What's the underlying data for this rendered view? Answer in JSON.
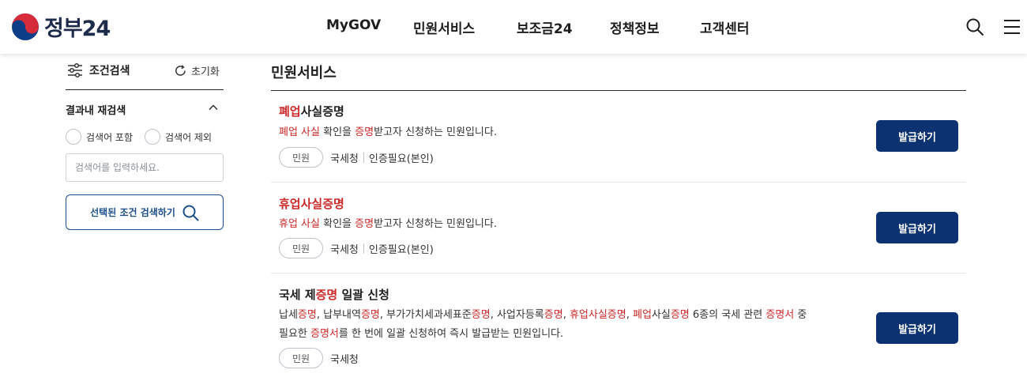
{
  "header": {
    "logo_text": "정부24",
    "nav": [
      "MyGOV",
      "민원서비스",
      "보조금24",
      "정책정보",
      "고객센터"
    ],
    "icons": [
      "search-icon",
      "menu-icon"
    ]
  },
  "sidebar": {
    "title": "조건검색",
    "reset_label": "초기화",
    "refine_title": "결과내 재검색",
    "radio_include": "검색어 포함",
    "radio_exclude": "검색어 제외",
    "search_placeholder": "검색어를 입력하세요.",
    "search_button": "선택된 조건 검색하기"
  },
  "main": {
    "section_title": "민원서비스",
    "issue_label": "발급하기",
    "items": [
      {
        "title": [
          {
            "t": "폐업",
            "h": true
          },
          {
            "t": "사실증명",
            "h": false
          }
        ],
        "desc_lines": [
          [
            {
              "t": "폐업 사실",
              "h": true
            },
            {
              "t": " 확인을 ",
              "h": false
            },
            {
              "t": "증명",
              "h": true
            },
            {
              "t": "받고자 신청하는 민원입니다.",
              "h": false
            }
          ]
        ],
        "tag": "민원",
        "org": "국세청",
        "auth": "인증필요(본인)"
      },
      {
        "title": [
          {
            "t": "휴업사실증명",
            "h": true
          }
        ],
        "desc_lines": [
          [
            {
              "t": "휴업 사실",
              "h": true
            },
            {
              "t": " 확인을 ",
              "h": false
            },
            {
              "t": "증명",
              "h": true
            },
            {
              "t": "받고자 신청하는 민원입니다.",
              "h": false
            }
          ]
        ],
        "tag": "민원",
        "org": "국세청",
        "auth": "인증필요(본인)"
      },
      {
        "title": [
          {
            "t": "국세 제",
            "h": false
          },
          {
            "t": "증명",
            "h": true
          },
          {
            "t": " 일괄 신청",
            "h": false
          }
        ],
        "desc_lines": [
          [
            {
              "t": "납세",
              "h": false
            },
            {
              "t": "증명",
              "h": true
            },
            {
              "t": ", 납부내역",
              "h": false
            },
            {
              "t": "증명",
              "h": true
            },
            {
              "t": ", 부가가치세과세표준",
              "h": false
            },
            {
              "t": "증명",
              "h": true
            },
            {
              "t": ", 사업자등록",
              "h": false
            },
            {
              "t": "증명",
              "h": true
            },
            {
              "t": ", ",
              "h": false
            },
            {
              "t": "휴업사실증명",
              "h": true
            },
            {
              "t": ", ",
              "h": false
            },
            {
              "t": "폐업",
              "h": true
            },
            {
              "t": "사실",
              "h": false
            },
            {
              "t": "증명",
              "h": true
            },
            {
              "t": " 6종의 국세 관련 ",
              "h": false
            },
            {
              "t": "증명서",
              "h": true
            },
            {
              "t": " 중",
              "h": false
            }
          ],
          [
            {
              "t": "필요한 ",
              "h": false
            },
            {
              "t": "증명서",
              "h": true
            },
            {
              "t": "를 한 번에 일괄 신청하여 즉시 발급받는 민원입니다.",
              "h": false
            }
          ]
        ],
        "tag": "민원",
        "org": "국세청",
        "auth": ""
      }
    ]
  },
  "colors": {
    "brand_navy": "#0d3272",
    "highlight_red": "#cc2a2a",
    "outline_blue": "#1d4f8c"
  }
}
